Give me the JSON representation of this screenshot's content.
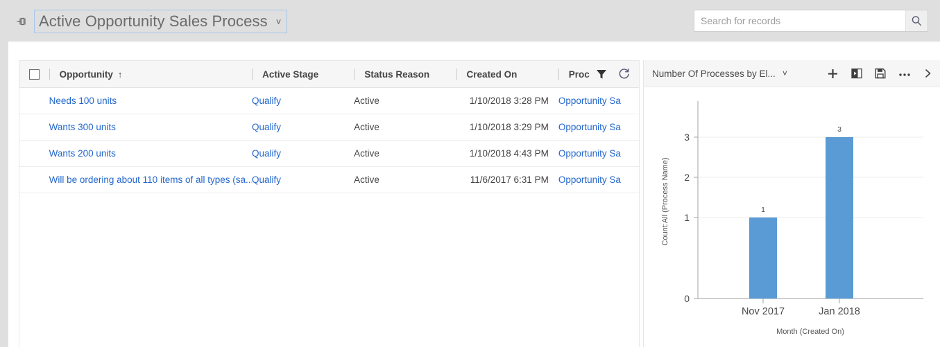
{
  "topbar": {
    "pin_icon": "pin-icon",
    "view_selector": {
      "label": "Active Opportunity Sales Process",
      "chevron": "˅"
    },
    "search": {
      "placeholder": "Search for records",
      "value": "",
      "button_icon": "search-icon"
    }
  },
  "grid": {
    "select_all_checkbox": "",
    "columns": [
      {
        "key": "opportunity",
        "label": "Opportunity",
        "sort": "↑"
      },
      {
        "key": "stage",
        "label": "Active Stage",
        "sort": ""
      },
      {
        "key": "status",
        "label": "Status Reason",
        "sort": ""
      },
      {
        "key": "created",
        "label": "Created On",
        "sort": ""
      },
      {
        "key": "process",
        "label": "Proc",
        "sort": ""
      }
    ],
    "tools": [
      {
        "name": "filter-icon",
        "label": "Filter"
      },
      {
        "name": "refresh-icon",
        "label": "Refresh"
      }
    ],
    "rows": [
      {
        "opportunity": "Needs 100 units",
        "stage": "Qualify",
        "status": "Active",
        "created": "1/10/2018 3:28 PM",
        "process": "Opportunity Sa"
      },
      {
        "opportunity": "Wants 300 units",
        "stage": "Qualify",
        "status": "Active",
        "created": "1/10/2018 3:29 PM",
        "process": "Opportunity Sa"
      },
      {
        "opportunity": "Wants 200 units",
        "stage": "Qualify",
        "status": "Active",
        "created": "1/10/2018 4:43 PM",
        "process": "Opportunity Sa"
      },
      {
        "opportunity": "Will be ordering about 110 items of all types (sa...",
        "stage": "Qualify",
        "status": "Active",
        "created": "11/6/2017 6:31 PM",
        "process": "Opportunity Sa"
      }
    ]
  },
  "splitter": {
    "name": "panel-splitter"
  },
  "chart_panel": {
    "title": "Number Of Processes by El...",
    "title_chevron": "˅",
    "tools": [
      {
        "name": "add-chart-icon",
        "label": "+"
      },
      {
        "name": "expand-panel-icon",
        "label": "Expand"
      },
      {
        "name": "save-icon",
        "label": "Save"
      },
      {
        "name": "more-options-icon",
        "label": "•••"
      },
      {
        "name": "collapse-right-icon",
        "label": "›"
      }
    ]
  },
  "chart_data": {
    "type": "bar",
    "title": "",
    "categories": [
      "Nov 2017",
      "Jan 2018"
    ],
    "values": [
      1,
      3
    ],
    "data_labels": [
      "1",
      "3"
    ],
    "xlabel": "Month (Created On)",
    "ylabel": "Count:All (Process Name)",
    "ylim": [
      0,
      3.4
    ],
    "yticks": [
      0,
      1,
      2,
      3
    ],
    "ytick_labels": [
      "0",
      "1",
      "2",
      "3"
    ],
    "grid": true,
    "legend": false,
    "bar_color": "#5B9BD5",
    "axis_color": "#b0b0b0",
    "grid_color": "#ededed"
  }
}
